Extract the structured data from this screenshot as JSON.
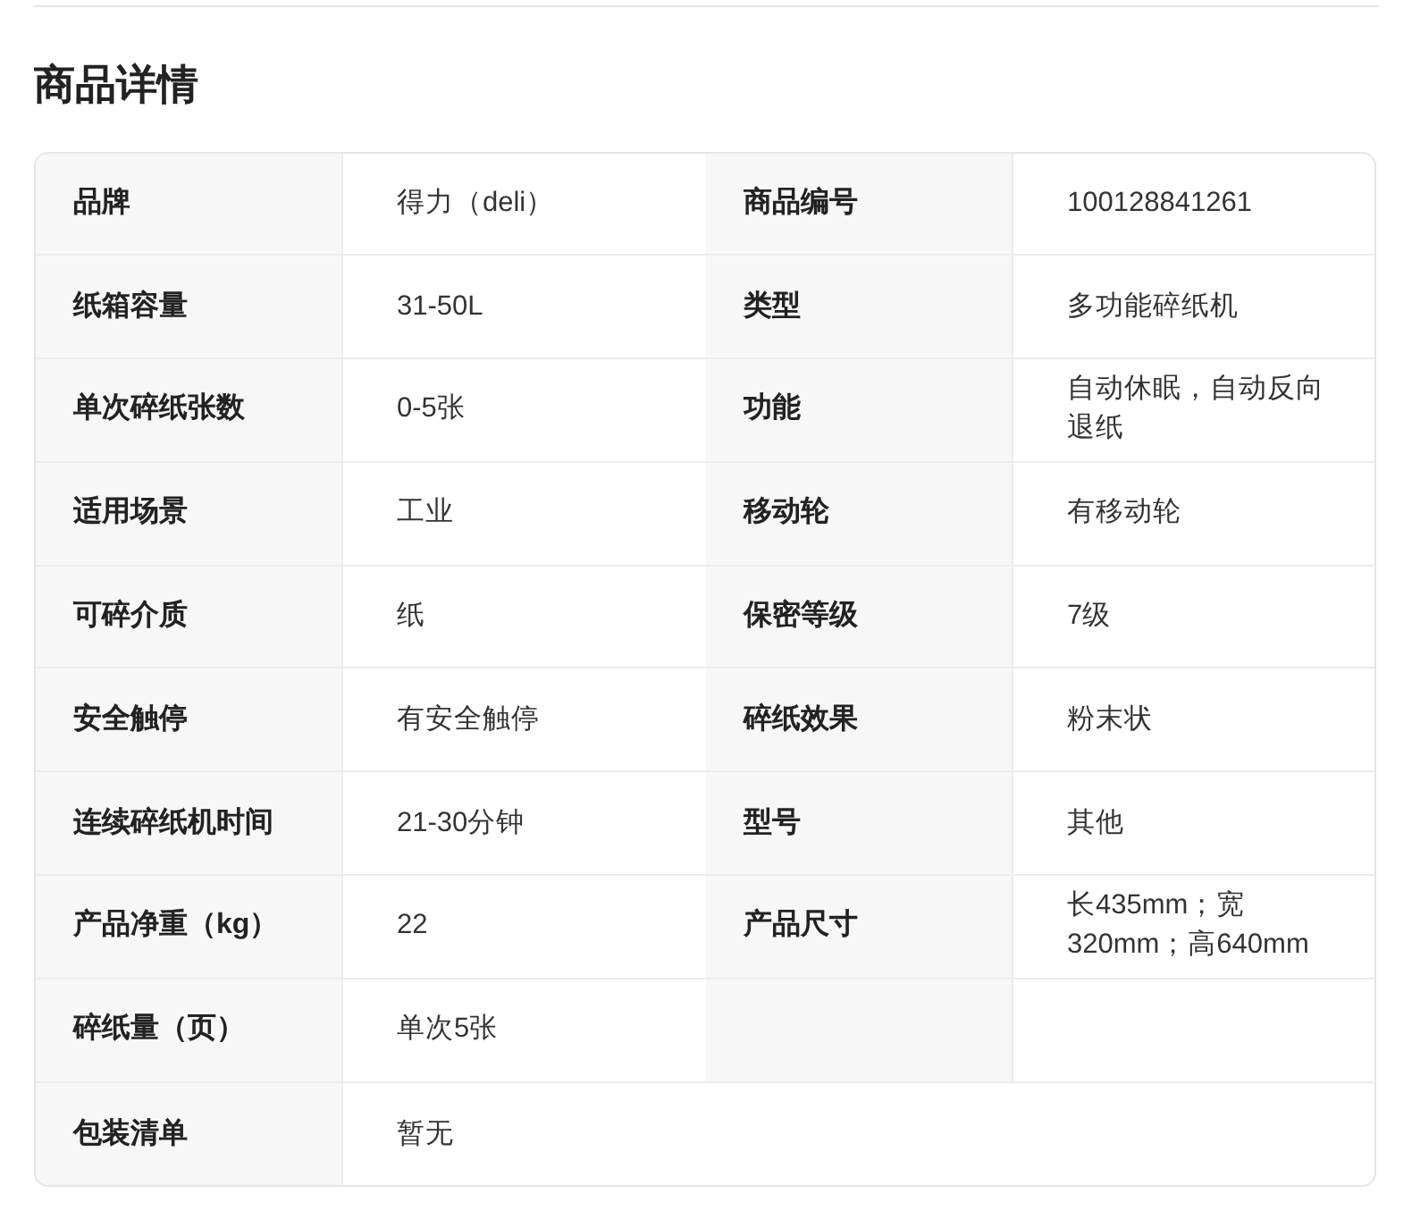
{
  "title": "商品详情",
  "rows": [
    {
      "kind": "half",
      "pairs": [
        {
          "label": "品牌",
          "value": "得力（deli）"
        },
        {
          "label": "商品编号",
          "value": "100128841261"
        }
      ]
    },
    {
      "kind": "half",
      "pairs": [
        {
          "label": "纸箱容量",
          "value": "31-50L"
        },
        {
          "label": "类型",
          "value": "多功能碎纸机"
        }
      ]
    },
    {
      "kind": "half",
      "pairs": [
        {
          "label": "单次碎纸张数",
          "value": "0-5张"
        },
        {
          "label": "功能",
          "value": "自动休眠，自动反向退纸"
        }
      ]
    },
    {
      "kind": "half",
      "pairs": [
        {
          "label": "适用场景",
          "value": "工业"
        },
        {
          "label": "移动轮",
          "value": "有移动轮"
        }
      ]
    },
    {
      "kind": "half",
      "pairs": [
        {
          "label": "可碎介质",
          "value": "纸"
        },
        {
          "label": "保密等级",
          "value": "7级"
        }
      ]
    },
    {
      "kind": "half",
      "pairs": [
        {
          "label": "安全触停",
          "value": "有安全触停"
        },
        {
          "label": "碎纸效果",
          "value": "粉末状"
        }
      ]
    },
    {
      "kind": "half",
      "pairs": [
        {
          "label": "连续碎纸机时间",
          "value": "21-30分钟"
        },
        {
          "label": "型号",
          "value": "其他"
        }
      ]
    },
    {
      "kind": "half",
      "pairs": [
        {
          "label": "产品净重（kg）",
          "value": "22"
        },
        {
          "label": "产品尺寸",
          "value": "长435mm；宽320mm；高640mm"
        }
      ]
    },
    {
      "kind": "half",
      "pairs": [
        {
          "label": "碎纸量（页）",
          "value": "单次5张"
        }
      ]
    },
    {
      "kind": "wide",
      "pairs": [
        {
          "label": "包装清单",
          "value": "暂无"
        }
      ]
    }
  ]
}
